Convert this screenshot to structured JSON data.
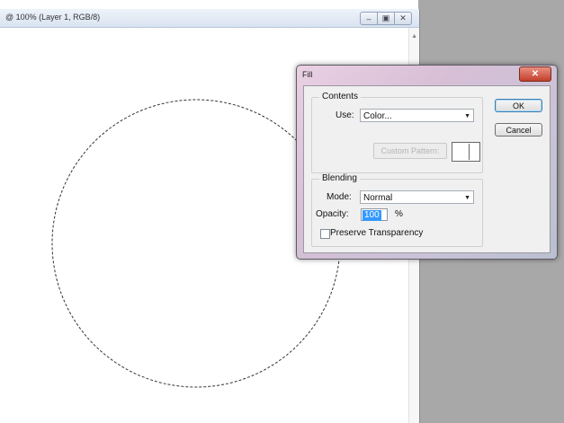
{
  "document_window": {
    "title": "@ 100% (Layer 1, RGB/8)",
    "controls": {
      "minimize": "–",
      "maximize": "▣",
      "close": "✕"
    }
  },
  "fill_dialog": {
    "title": "Fill",
    "close_glyph": "✕",
    "contents": {
      "group_label": "Contents",
      "use_label": "Use:",
      "use_value": "Color...",
      "custom_pattern_label": "Custom Pattern:"
    },
    "blending": {
      "group_label": "Blending",
      "mode_label": "Mode:",
      "mode_value": "Normal",
      "opacity_label": "Opacity:",
      "opacity_value": "100",
      "opacity_unit": "%",
      "preserve_transparency_label": "Preserve Transparency",
      "preserve_transparency_checked": false
    },
    "ok_label": "OK",
    "cancel_label": "Cancel"
  },
  "colors": {
    "workspace_gray": "#a8a8a8",
    "selection_highlight": "#3399ff"
  }
}
